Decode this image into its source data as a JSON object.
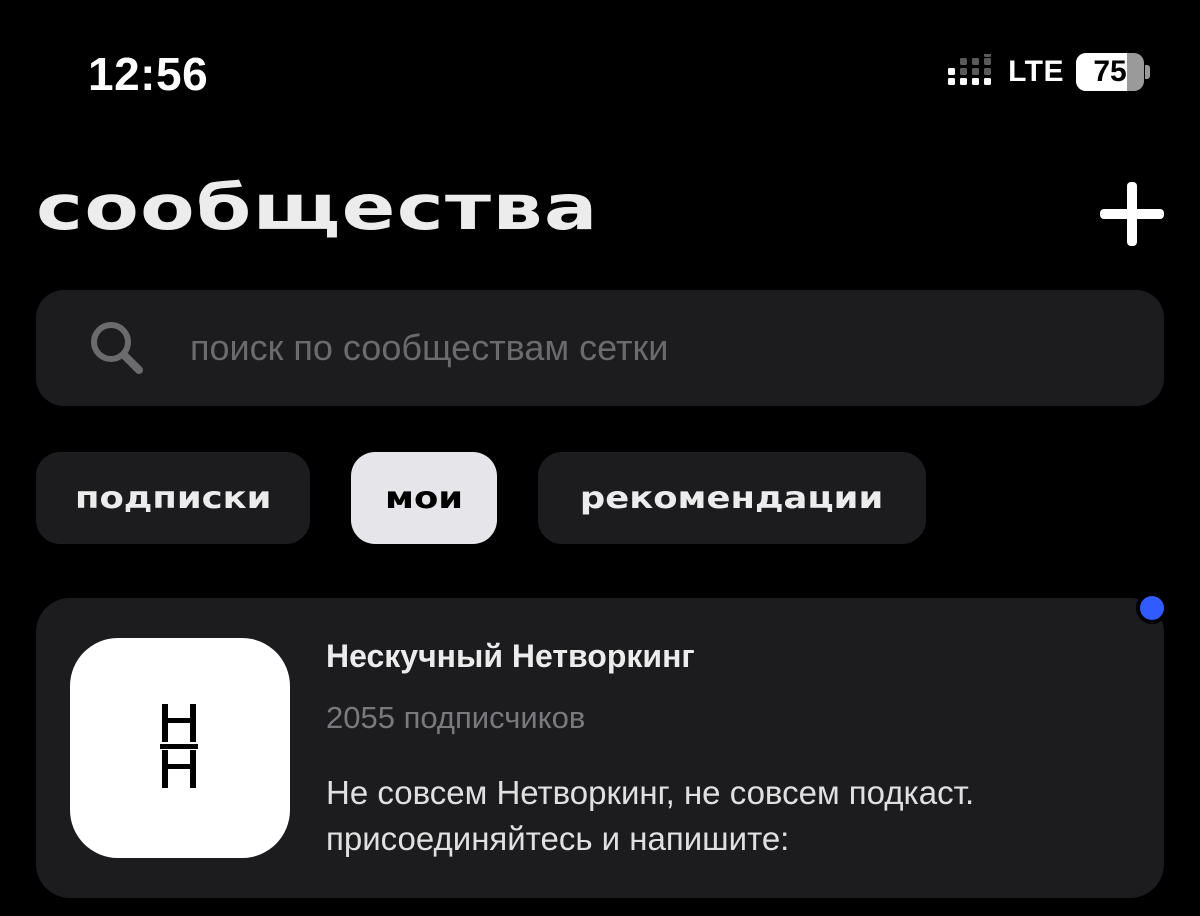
{
  "status_bar": {
    "time": "12:56",
    "network": "LTE",
    "battery_level": "75",
    "battery_fraction": 0.75,
    "signal_bars_active": 1
  },
  "header": {
    "title": "сообщества",
    "add_icon": "plus-icon"
  },
  "search": {
    "icon": "search-icon",
    "placeholder": "поиск по сообществам сетки",
    "value": ""
  },
  "tabs": [
    {
      "label": "подписки",
      "active": false
    },
    {
      "label": "мои",
      "active": true
    },
    {
      "label": "рекомендации",
      "active": false
    }
  ],
  "communities": [
    {
      "logo_icon": "nn-logo-icon",
      "name": "Нескучный Нетворкинг",
      "subscribers": "2055 подписчиков",
      "description": "Не совсем Нетворкинг, не совсем подкаст. присоединяйтесь и напишите:",
      "unread": true
    }
  ],
  "colors": {
    "background": "#000000",
    "surface": "#1c1c1e",
    "active_tab": "#e5e5ea",
    "unread_dot": "#2f5bff",
    "muted_text": "#7a7a7e"
  }
}
